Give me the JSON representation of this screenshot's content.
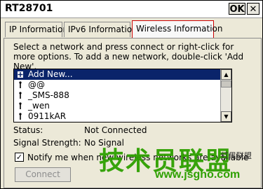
{
  "window": {
    "title": "RT28701",
    "ok_label": "OK",
    "close_label": "✕"
  },
  "tabs": [
    {
      "label": "IP Information"
    },
    {
      "label": "IPv6 Information"
    },
    {
      "label": "Wireless Information"
    }
  ],
  "instructions": "Select a network and press connect or right-click for more options.  To add a new network, double-click 'Add New'.",
  "networks": [
    {
      "label": "Add New...",
      "selected": true
    },
    {
      "label": "@@"
    },
    {
      "label": "_SMS-888"
    },
    {
      "label": "_wen"
    },
    {
      "label": "0911kAR"
    }
  ],
  "status": {
    "label": "Status:",
    "value": "Not Connected"
  },
  "signal": {
    "label": "Signal Strength:",
    "value": "No Signal"
  },
  "notify": {
    "label": "Notify me when new wireless networks are available",
    "checked": true
  },
  "connect_label": "Connect",
  "watermark": {
    "main": "技术员联盟",
    "url": "www.jsgho.com",
    "small": "红黑联盟"
  }
}
